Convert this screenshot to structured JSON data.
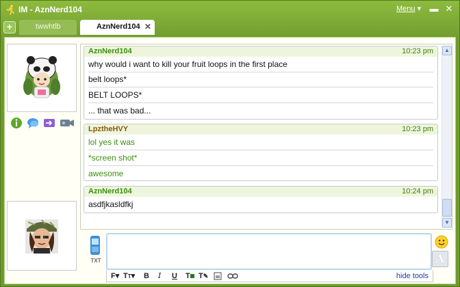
{
  "window": {
    "title": "IM - AznNerd104",
    "menu_label": "Menu"
  },
  "tabs": [
    {
      "label": "twwhtlb",
      "active": false
    },
    {
      "label": "AznNerd104",
      "active": true
    }
  ],
  "icons": {
    "add_tab": "plus-icon",
    "close_tab": "close-icon",
    "info": "info-icon",
    "chat": "chat-bubble-icon",
    "send": "forward-arrow-icon",
    "webcam": "webcam-icon",
    "sms": "mobile-phone-icon",
    "emoticon": "smiley-icon",
    "font": "font-style-icon"
  },
  "add_tab_symbol": "+",
  "close_tab_symbol": "✕",
  "messages": [
    {
      "sender": "AznNerd104",
      "time": "10:23 pm",
      "sender_color": "#3a8f0c",
      "lines": [
        "why would i want to kill your fruit loops in the first place",
        "belt loops*",
        "BELT LOOPS*",
        "... that was bad..."
      ]
    },
    {
      "sender": "LpztheHVY",
      "time": "10:23 pm",
      "sender_color": "#8a5a0a",
      "lines": [
        "lol yes it was",
        "*screen shot*",
        "awesome"
      ]
    },
    {
      "sender": "AznNerd104",
      "time": "10:24 pm",
      "sender_color": "#3a8f0c",
      "lines": [
        "asdfjkasldfkj"
      ]
    }
  ],
  "sms_label": "TXT",
  "input": {
    "value": "",
    "placeholder": ""
  },
  "font_box_letter": "A",
  "toolbar": {
    "font_label": "F",
    "size_label": "T",
    "bold": "B",
    "italic": "I",
    "underline": "U",
    "text_color": "T",
    "bg_color": "T",
    "hide_tools": "hide tools"
  },
  "colors": {
    "window_green": "#6f9a2e",
    "header_bg": "#edf6dc",
    "link_blue": "#1c3f9a"
  }
}
